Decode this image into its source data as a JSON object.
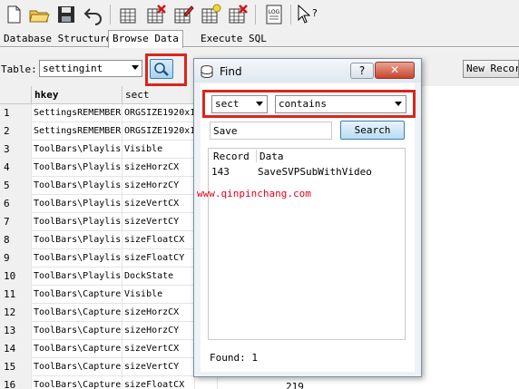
{
  "toolbar": {
    "icons": [
      "new-file-icon",
      "open-folder-icon",
      "save-icon",
      "undo-icon",
      "table-icon",
      "delete-table-icon",
      "edit-table-icon",
      "new-table-icon",
      "remove-table-icon",
      "log-icon",
      "help-cursor-icon"
    ],
    "log_label": "LOG"
  },
  "tabs": [
    {
      "label": "Database Structure",
      "active": false
    },
    {
      "label": "Browse Data",
      "active": true
    },
    {
      "label": "Execute SQL",
      "active": false
    }
  ],
  "filter": {
    "table_label": "Table:",
    "table_value": "settingint",
    "new_record_label": "New Record"
  },
  "grid": {
    "columns": [
      "",
      "hkey",
      "sect",
      ""
    ],
    "rows": [
      {
        "n": "1",
        "hkey": "SettingsREMEMBER",
        "sect": "ORGSIZE1920x1"
      },
      {
        "n": "2",
        "hkey": "SettingsREMEMBER",
        "sect": "ORGSIZE1920x1"
      },
      {
        "n": "3",
        "hkey": "ToolBars\\Playlis",
        "sect": "Visible"
      },
      {
        "n": "4",
        "hkey": "ToolBars\\Playlis",
        "sect": "sizeHorzCX"
      },
      {
        "n": "5",
        "hkey": "ToolBars\\Playlis",
        "sect": "sizeHorzCY"
      },
      {
        "n": "6",
        "hkey": "ToolBars\\Playlis",
        "sect": "sizeVertCX"
      },
      {
        "n": "7",
        "hkey": "ToolBars\\Playlis",
        "sect": "sizeVertCY"
      },
      {
        "n": "8",
        "hkey": "ToolBars\\Playlis",
        "sect": "sizeFloatCX"
      },
      {
        "n": "9",
        "hkey": "ToolBars\\Playlis",
        "sect": "sizeFloatCY"
      },
      {
        "n": "10",
        "hkey": "ToolBars\\Playlis",
        "sect": "DockState"
      },
      {
        "n": "11",
        "hkey": "ToolBars\\Capture",
        "sect": "Visible"
      },
      {
        "n": "12",
        "hkey": "ToolBars\\Capture",
        "sect": "sizeHorzCX"
      },
      {
        "n": "13",
        "hkey": "ToolBars\\Capture",
        "sect": "sizeHorzCY"
      },
      {
        "n": "14",
        "hkey": "ToolBars\\Capture",
        "sect": "sizeVertCX"
      },
      {
        "n": "15",
        "hkey": "ToolBars\\Capture",
        "sect": "sizeVertCY"
      },
      {
        "n": "16",
        "hkey": "ToolBars\\Capture",
        "sect": "sizeFloatCX"
      }
    ],
    "visible_value": "219"
  },
  "find_dialog": {
    "title": "Find",
    "help_label": "?",
    "close_label": "✕",
    "field_value": "sect",
    "operator_value": "contains",
    "search_text": "Save",
    "search_button": "Search",
    "result_headers": [
      "Record",
      "Data"
    ],
    "results": [
      {
        "record": "143",
        "data": "SaveSVPSubWithVideo"
      }
    ],
    "found_text": "Found: 1"
  },
  "watermark": "www.qinpinchang.com",
  "colors": {
    "highlight": "#d9261c",
    "watermark": "#e1001b",
    "accent": "#3c7fb1"
  }
}
